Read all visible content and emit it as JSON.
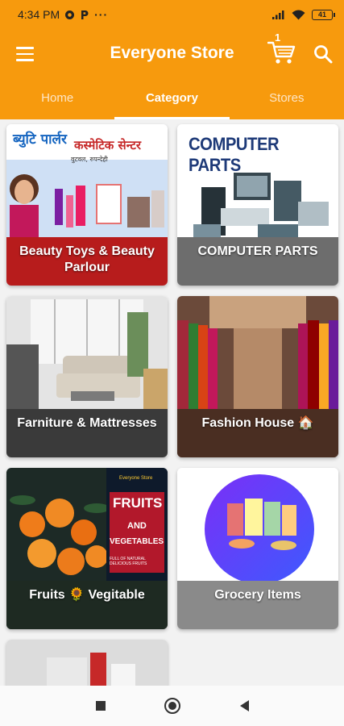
{
  "status_bar": {
    "time": "4:34 PM",
    "battery": "41"
  },
  "app_bar": {
    "title": "Everyone Store",
    "cart_count": "1"
  },
  "tabs": [
    {
      "label": "Home",
      "active": false
    },
    {
      "label": "Category",
      "active": true
    },
    {
      "label": "Stores",
      "active": false
    }
  ],
  "categories": [
    {
      "name": "Beauty Toys & Beauty Parlour",
      "banner": {
        "line1": "ब्युटि पार्लर",
        "line2": "कस्मेटिक सेन्टर",
        "line3": "वुटवल, रुपन्देही"
      }
    },
    {
      "name": "COMPUTER PARTS",
      "banner": {
        "line1": "COMPUTER PARTS"
      }
    },
    {
      "name": "Farniture & Mattresses"
    },
    {
      "name": "Fashion House 🏠"
    },
    {
      "name": "Fruits 🌻 Vegitable",
      "banner": {
        "line1": "FRUITS",
        "line2": "AND",
        "line3": "VEGETABLES",
        "line4": "FULL OF NATURAL DELICIOUS FRUITS",
        "brand": "Everyone Store"
      }
    },
    {
      "name": "Grocery Items"
    }
  ],
  "colors": {
    "brand_orange": "#f79a0d",
    "white": "#ffffff"
  }
}
